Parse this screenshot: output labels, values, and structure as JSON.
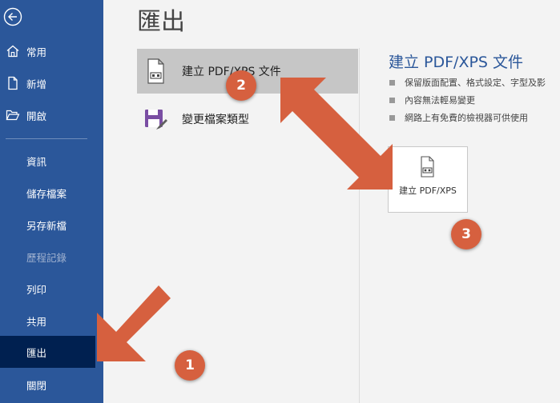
{
  "sidebar": {
    "items": [
      {
        "label": "常用",
        "icon": "home-icon"
      },
      {
        "label": "新增",
        "icon": "new-document-icon"
      },
      {
        "label": "開啟",
        "icon": "folder-open-icon"
      },
      {
        "label": "資訊"
      },
      {
        "label": "儲存檔案"
      },
      {
        "label": "另存新檔"
      },
      {
        "label": "歷程記錄",
        "disabled": true
      },
      {
        "label": "列印"
      },
      {
        "label": "共用"
      },
      {
        "label": "匯出",
        "selected": true
      },
      {
        "label": "關閉"
      }
    ]
  },
  "main": {
    "title": "匯出",
    "options": [
      {
        "label": "建立 PDF/XPS 文件",
        "icon": "pdf-document-icon",
        "selected": true
      },
      {
        "label": "變更檔案類型",
        "icon": "save-file-type-icon"
      }
    ]
  },
  "panel": {
    "title": "建立 PDF/XPS 文件",
    "bullets": [
      "保留版面配置、格式設定、字型及影",
      "內容無法輕易變更",
      "網路上有免費的檢視器可供使用"
    ],
    "button_label": "建立 PDF/XPS"
  },
  "annotations": {
    "badges": [
      "1",
      "2",
      "3"
    ],
    "color": "#d6603f"
  },
  "colors": {
    "sidebar": "#2b579a",
    "sidebar_selected": "#002050",
    "accent": "#2b579a"
  }
}
